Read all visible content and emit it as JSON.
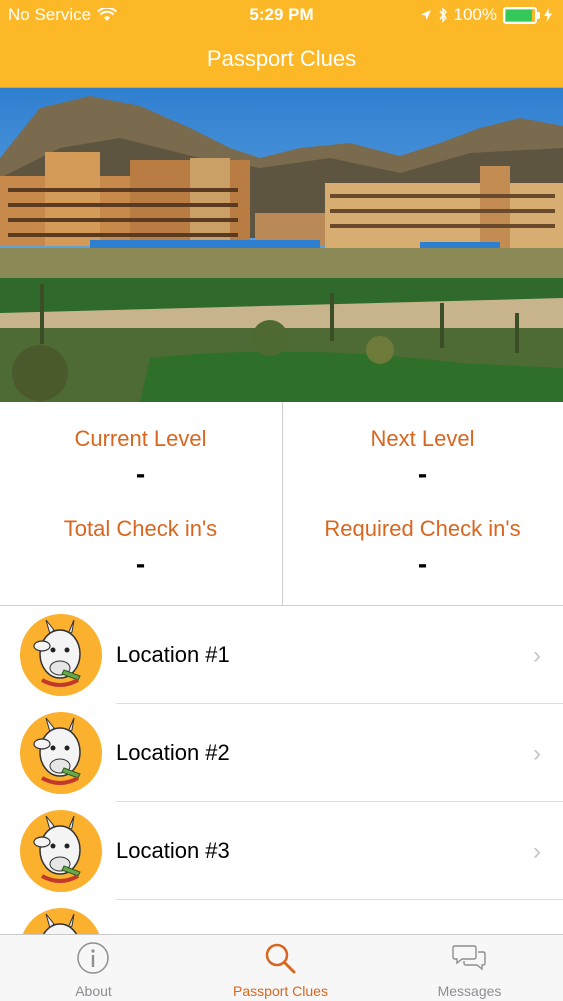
{
  "status_bar": {
    "carrier": "No Service",
    "time": "5:29 PM",
    "battery": "100%",
    "battery_level": 1.0
  },
  "nav": {
    "title": "Passport Clues"
  },
  "stats": {
    "current_level_label": "Current Level",
    "current_level_value": "-",
    "next_level_label": "Next Level",
    "next_level_value": "-",
    "total_checkins_label": "Total Check in's",
    "total_checkins_value": "-",
    "required_checkins_label": "Required Check in's",
    "required_checkins_value": "-"
  },
  "locations": [
    {
      "label": "Location #1"
    },
    {
      "label": "Location #2"
    },
    {
      "label": "Location #3"
    },
    {
      "label": ""
    }
  ],
  "tabbar": {
    "tabs": [
      {
        "label": "About",
        "icon": "info-icon"
      },
      {
        "label": "Passport Clues",
        "icon": "search-icon"
      },
      {
        "label": "Messages",
        "icon": "messages-icon"
      }
    ],
    "active": "Passport Clues"
  },
  "colors": {
    "brand": "#fcb827",
    "accent": "#d9661e",
    "tab_inactive": "#8e8e93"
  }
}
